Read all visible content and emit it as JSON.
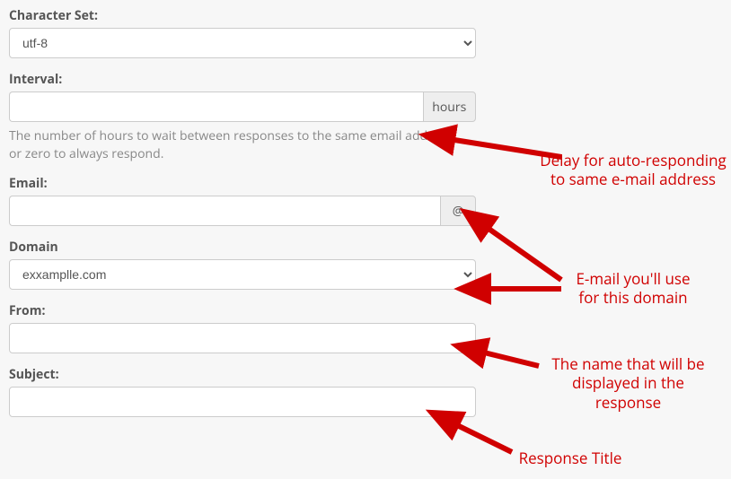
{
  "charset": {
    "label": "Character Set:",
    "value": "utf-8"
  },
  "interval": {
    "label": "Interval:",
    "value": "",
    "addon": "hours",
    "help": "The number of hours to wait between responses to the same email address, or zero to always respond."
  },
  "email": {
    "label": "Email:",
    "value": "",
    "addon": "@"
  },
  "domain": {
    "label": "Domain",
    "value": "exxamplle.com"
  },
  "from": {
    "label": "From:",
    "value": ""
  },
  "subject": {
    "label": "Subject:",
    "value": ""
  },
  "annotations": {
    "delay": "Delay for auto-responding\nto same e-mail address",
    "emailuse": "E-mail you'll use\nfor this domain",
    "name": "The name that will be\ndisplayed in the\nresponse",
    "title": "Response Title"
  }
}
